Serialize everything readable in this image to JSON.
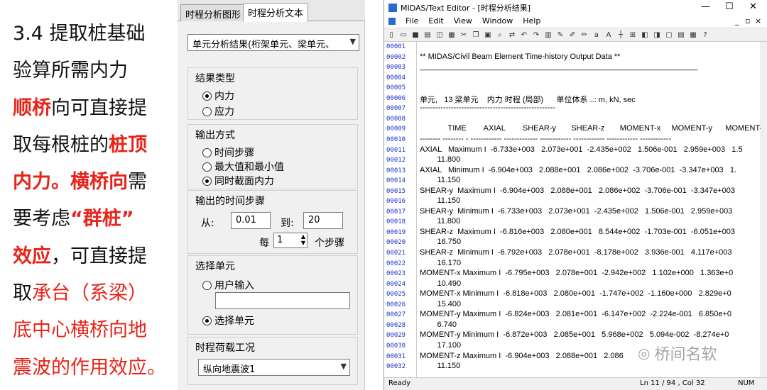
{
  "slide": {
    "line1": "3.4 提取桩基础",
    "line2": "验算所需内力",
    "line3a": "顺桥",
    "line3b": "向可直接提",
    "line4a": "取每根桩的",
    "line4b": "桩顶",
    "line5a": "内力。",
    "line5b": "横桥向",
    "line5c": "需",
    "line6a": "要考虑",
    "line6b": "“群桩”",
    "line7a": "效应",
    "line7b": "，可直接提",
    "line8a": "取",
    "line8b": "承台（系梁）",
    "line9": "底中心横桥向地",
    "line10": "震波的作用效应。"
  },
  "panel": {
    "tab1": "时程分析图形",
    "tab2": "时程分析文本",
    "result_select": "单元分析结果(桁架单元、梁单元、",
    "result_type": {
      "title": "结果类型",
      "opt1": "内力",
      "opt2": "应力"
    },
    "output_mode": {
      "title": "输出方式",
      "opt1": "时间步骤",
      "opt2": "最大值和最小值",
      "opt3": "同时截面内力"
    },
    "time_step": {
      "title": "输出的时间步骤",
      "from_label": "从:",
      "from_value": "0.01",
      "to_label": "到:",
      "to_value": "20",
      "every_label": "每",
      "every_value": "1",
      "step_unit": "个步骤"
    },
    "select_element": {
      "title": "选择单元",
      "opt1": "用户输入",
      "opt2": "选择单元"
    },
    "load_case": {
      "title": "时程荷载工况",
      "value": "纵向地震波1"
    }
  },
  "editor": {
    "title": "MIDAS/Text Editor - [时程分析结果]",
    "menu": [
      "File",
      "Edit",
      "View",
      "Window",
      "Help"
    ],
    "status_ready": "Ready",
    "status_pos": "Ln 11 / 94 , Col 32",
    "status_num": "NUM",
    "lines": [
      {
        "n": "00001",
        "t": ""
      },
      {
        "n": "00002",
        "t": "** MIDAS/Civil Beam Element Time-history Output Data **"
      },
      {
        "n": "00003",
        "t": "________________________________________________________________"
      },
      {
        "n": "00004",
        "t": ""
      },
      {
        "n": "00005",
        "t": ""
      },
      {
        "n": "00006",
        "t": "单元,   13 梁单元    内力 时程 (局部)      单位体系 ..: m, kN, sec"
      },
      {
        "n": "00007",
        "t": "----------------------------------------------------"
      },
      {
        "n": "00008",
        "t": ""
      },
      {
        "n": "00009",
        "t": "             TIME        AXIAL        SHEAR-y       SHEAR-z       MOMENT-x     MOMENT-y      MOMENT-z"
      },
      {
        "n": "00010",
        "t": "-------- -------- - ------------ ------------- ------------ ------------ ------------ ------------"
      },
      {
        "n": "00011",
        "t": "AXIAL   Maximum I  -6.733e+003   2.073e+001  -2.435e+002   1.506e-001   2.959e+003   1.5"
      },
      {
        "n": "00012",
        "t": "        11.800"
      },
      {
        "n": "00013",
        "t": "AXIAL   Minimum I  -6.904e+003   2.088e+001   2.086e+002  -3.706e-001  -3.347e+003   1."
      },
      {
        "n": "00014",
        "t": "        11.150"
      },
      {
        "n": "00015",
        "t": "SHEAR-y  Maximum I  -6.904e+003   2.088e+001   2.086e+002  -3.706e-001  -3.347e+003"
      },
      {
        "n": "00016",
        "t": "        11.150"
      },
      {
        "n": "00017",
        "t": "SHEAR-y  Minimum I  -6.733e+003   2.073e+001  -2.435e+002   1.506e-001   2.959e+003"
      },
      {
        "n": "00018",
        "t": "        11.800"
      },
      {
        "n": "00019",
        "t": "SHEAR-z  Maximum I  -6.816e+003   2.080e+001   8.544e+002  -1.703e-001  -6.051e+003"
      },
      {
        "n": "00020",
        "t": "        16.750"
      },
      {
        "n": "00021",
        "t": "SHEAR-z  Minimum I  -6.792e+003   2.078e+001  -8.178e+002   3.936e-001   4.117e+003"
      },
      {
        "n": "00022",
        "t": "        16.170"
      },
      {
        "n": "00023",
        "t": "MOMENT-x Maximum I  -6.795e+003   2.078e+001  -2.942e+002   1.102e+000   1.363e+0"
      },
      {
        "n": "00024",
        "t": "        10.490"
      },
      {
        "n": "00025",
        "t": "MOMENT-x Minimum I  -6.818e+003   2.080e+001  -1.747e+002  -1.160e+000   2.829e+0"
      },
      {
        "n": "00026",
        "t": "        15.400"
      },
      {
        "n": "00027",
        "t": "MOMENT-y Maximum I  -6.824e+003   2.081e+001  -6.147e+002  -2.224e-001   6.850e+0"
      },
      {
        "n": "00028",
        "t": "        6.740"
      },
      {
        "n": "00029",
        "t": "MOMENT-y Minimum I  -6.872e+003   2.085e+001   5.968e+002   5.094e-002  -8.274e+0"
      },
      {
        "n": "00030",
        "t": "        17.100"
      },
      {
        "n": "00031",
        "t": "MOMENT-z Maximum I  -6.904e+003   2.088e+001   2.086"
      },
      {
        "n": "00032",
        "t": "        11.150"
      }
    ]
  },
  "watermark": "桥间名软"
}
